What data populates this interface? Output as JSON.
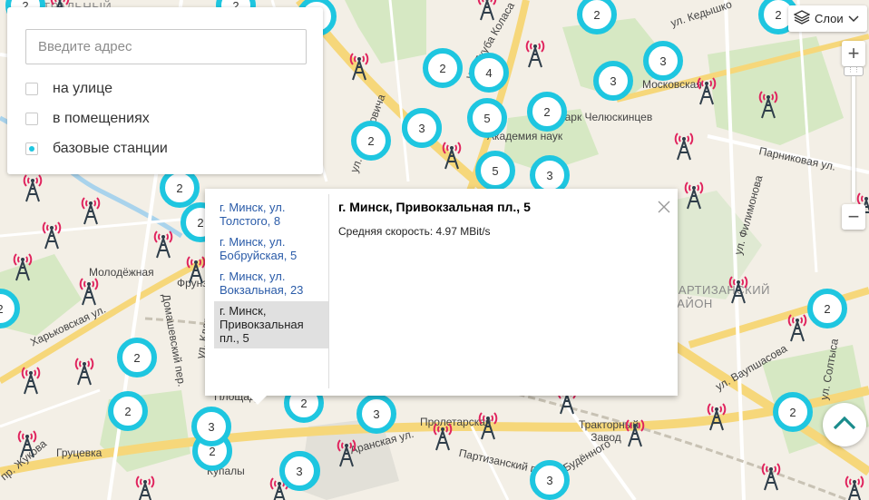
{
  "map": {
    "labels": [
      {
        "text": "Центральный",
        "kind": "district"
      },
      {
        "text": "ул. Якуба Коласа",
        "kind": "street"
      },
      {
        "text": "Московская",
        "kind": "metro"
      },
      {
        "text": "ул. Кедышко",
        "kind": "street"
      },
      {
        "text": "Парк Челюскинцев",
        "kind": "place"
      },
      {
        "text": "Академия наук",
        "kind": "metro"
      },
      {
        "text": "ул. Богдановича",
        "kind": "street"
      },
      {
        "text": "Парниковая ул.",
        "kind": "street"
      },
      {
        "text": "Молодёжная",
        "kind": "metro"
      },
      {
        "text": "Харьковская ул.",
        "kind": "street"
      },
      {
        "text": "Домашевский пер.",
        "kind": "street"
      },
      {
        "text": "ул. Клары Цеткин",
        "kind": "street"
      },
      {
        "text": "Партизанский район",
        "kind": "district"
      },
      {
        "text": "Пролетарская",
        "kind": "metro"
      },
      {
        "text": "Тракторный Завод",
        "kind": "metro"
      },
      {
        "text": "Груцевка",
        "kind": "metro"
      },
      {
        "text": "Партизанский пр.",
        "kind": "street"
      },
      {
        "text": "ул. Ваупшасова",
        "kind": "street"
      },
      {
        "text": "ул. Филимонова",
        "kind": "street"
      },
      {
        "text": "ул. Будённого",
        "kind": "street"
      },
      {
        "text": "Аранская ул.",
        "kind": "street"
      },
      {
        "text": "пр. Жукова",
        "kind": "street"
      },
      {
        "text": "ул. Солтыса",
        "kind": "street"
      },
      {
        "text": "Купалы",
        "kind": "metro"
      },
      {
        "text": "Фрунзе",
        "kind": "place"
      },
      {
        "text": "Площадь",
        "kind": "place"
      }
    ],
    "clusters": [
      "2",
      "2",
      "2",
      "2",
      "2",
      "4",
      "3",
      "3",
      "3",
      "2",
      "5",
      "2",
      "3",
      "5",
      "3",
      "2",
      "2",
      "2",
      "2",
      "2",
      "2",
      "3",
      "2",
      "3",
      "2",
      "3",
      "3",
      "3",
      "2",
      "2"
    ]
  },
  "filter": {
    "address_placeholder": "Введите адрес",
    "options": [
      {
        "label": "на улице",
        "checked": false
      },
      {
        "label": "в помещениях",
        "checked": false
      },
      {
        "label": "базовые станции",
        "checked": true
      }
    ]
  },
  "controls": {
    "layers_label": "Слои",
    "zoom_in": "+",
    "zoom_out": "−"
  },
  "balloon": {
    "items": [
      "г. Минск, ул. Толстого, 8",
      "г. Минск, ул. Бобруйская, 5",
      "г. Минск, ул. Вокзальная, 23",
      "г. Минск, Привокзальная пл., 5"
    ],
    "active_index": 3,
    "title": "г. Минск, Привокзальная пл., 5",
    "speed": "Средняя скорость: 4.97 MBit/s"
  },
  "colors": {
    "cluster": "#1ec6e0",
    "tower_waves": "#e0245e",
    "tower_body": "#2f3e4a",
    "accent_teal": "#1a8c8c"
  }
}
